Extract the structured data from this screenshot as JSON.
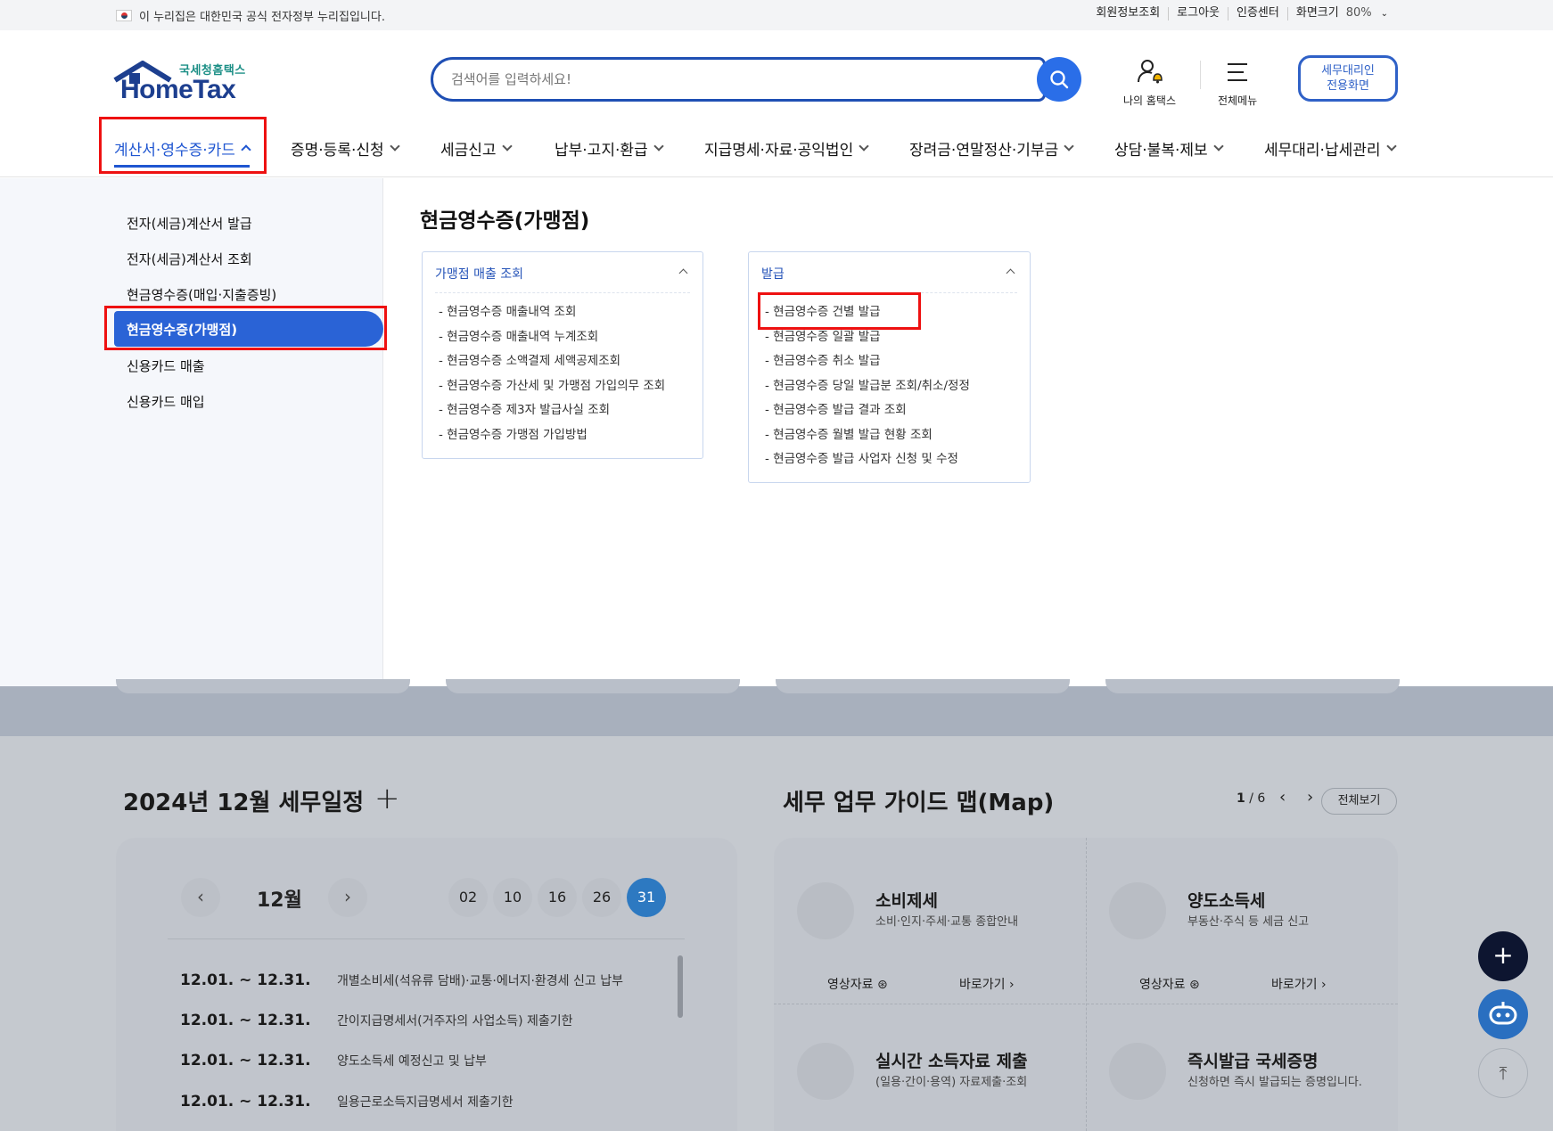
{
  "topbar": {
    "notice": "이 누리집은 대한민국 공식 전자정부 누리집입니다.",
    "links": [
      "회원정보조회",
      "로그아웃",
      "인증센터",
      "화면크기"
    ],
    "zoom": "80%"
  },
  "logo": {
    "kr": "국세청홈택스",
    "en": "HomeTax"
  },
  "search": {
    "placeholder": "검색어를 입력하세요!"
  },
  "header_icons": {
    "my_hometax": "나의 홈택스",
    "all_menu": "전체메뉴"
  },
  "agent_button": {
    "line1": "세무대리인",
    "line2": "전용화면"
  },
  "gnb": [
    "계산서·영수증·카드",
    "증명·등록·신청",
    "세금신고",
    "납부·고지·환급",
    "지급명세·자료·공익법인",
    "장려금·연말정산·기부금",
    "상담·불복·제보",
    "세무대리·납세관리"
  ],
  "submenu": [
    "전자(세금)계산서 발급",
    "전자(세금)계산서 조회",
    "현금영수증(매입·지출증빙)",
    "현금영수증(가맹점)",
    "신용카드 매출",
    "신용카드 매입"
  ],
  "mega_title": "현금영수증(가맹점)",
  "card1": {
    "title": "가맹점 매출 조회",
    "items": [
      "현금영수증 매출내역 조회",
      "현금영수증 매출내역 누계조회",
      "현금영수증 소액결제 세액공제조회",
      "현금영수증 가산세 및 가맹점 가입의무 조회",
      "현금영수증 제3자 발급사실 조회",
      "현금영수증 가맹점 가입방법"
    ]
  },
  "card2": {
    "title": "발급",
    "items": [
      "현금영수증 건별 발급",
      "현금영수증 일괄 발급",
      "현금영수증 취소 발급",
      "현금영수증 당일 발급분 조회/취소/정정",
      "현금영수증 발급 결과 조회",
      "현금영수증 월별 발급 현황 조회",
      "현금영수증 발급 사업자 신청 및 수정"
    ]
  },
  "schedule": {
    "title": "2024년 12월 세무일정",
    "month": "12월",
    "days": [
      "02",
      "10",
      "16",
      "26",
      "31"
    ],
    "items": [
      {
        "date": "12.01. ~ 12.31.",
        "text": "개별소비세(석유류 담배)·교통·에너지·환경세 신고 납부"
      },
      {
        "date": "12.01. ~ 12.31.",
        "text": "간이지급명세서(거주자의 사업소득) 제출기한"
      },
      {
        "date": "12.01. ~ 12.31.",
        "text": "양도소득세 예정신고 및 납부"
      },
      {
        "date": "12.01. ~ 12.31.",
        "text": "일용근로소득지급명세서 제출기한"
      }
    ]
  },
  "guide": {
    "title": "세무 업무 가이드 맵(Map)",
    "page": "1",
    "total": "6",
    "all_label": "전체보기",
    "video_label": "영상자료",
    "go_label": "바로가기",
    "cells": [
      {
        "name": "소비제세",
        "desc": "소비·인지·주세·교통 종합안내"
      },
      {
        "name": "양도소득세",
        "desc": "부동산·주식 등 세금 신고"
      },
      {
        "name": "실시간 소득자료 제출",
        "desc": "(일용·간이·용역) 자료제출·조회"
      },
      {
        "name": "즉시발급 국세증명",
        "desc": "신청하면 즉시 발급되는 증명입니다."
      }
    ]
  },
  "colors": {
    "primary": "#2a63d6",
    "brand": "#1d3f8f",
    "highlight": "#e11111"
  }
}
